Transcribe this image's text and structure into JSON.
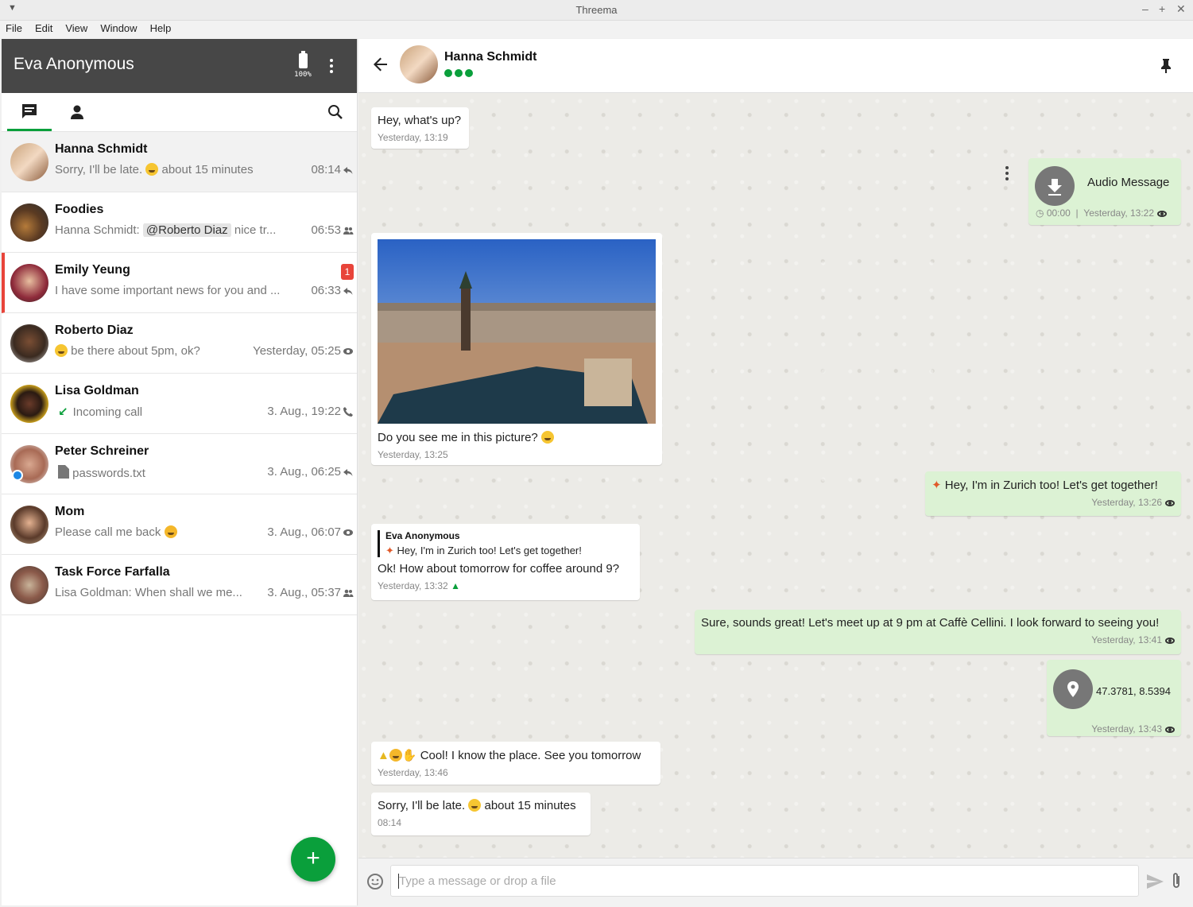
{
  "window": {
    "title": "Threema"
  },
  "menu": [
    "File",
    "Edit",
    "View",
    "Window",
    "Help"
  ],
  "sidebar": {
    "profile_name": "Eva Anonymous",
    "battery": "100%",
    "chats": [
      {
        "name": "Hanna Schmidt",
        "preview_a": "Sorry, I'll be late.",
        "preview_b": "about 15 minutes",
        "time": "08:14",
        "status": "reply-icon"
      },
      {
        "name": "Foodies",
        "preview_a": "Hanna Schmidt:",
        "mention": "@Roberto Diaz",
        "preview_b": "nice tr...",
        "time": "06:53",
        "status": "group-icon"
      },
      {
        "name": "Emily Yeung",
        "preview_a": "I have some important news for you and ...",
        "time": "06:33",
        "status": "reply-icon",
        "unread": "1"
      },
      {
        "name": "Roberto Diaz",
        "preview_a": "be there about 5pm, ok?",
        "time": "Yesterday, 05:25",
        "status": "eye-icon"
      },
      {
        "name": "Lisa Goldman",
        "preview_a": "Incoming call",
        "time": "3. Aug., 19:22",
        "status": "phone-icon"
      },
      {
        "name": "Peter Schreiner",
        "preview_a": "passwords.txt",
        "time": "3. Aug., 06:25",
        "status": "reply-icon"
      },
      {
        "name": "Mom",
        "preview_a": "Please call me back",
        "time": "3. Aug., 06:07",
        "status": "eye-icon"
      },
      {
        "name": "Task Force Farfalla",
        "preview_a": "Lisa Goldman: When shall we me...",
        "time": "3. Aug., 05:37",
        "status": "group-icon"
      }
    ],
    "fab": "+"
  },
  "chat": {
    "contact_name": "Hanna Schmidt",
    "messages": [
      {
        "text": "Hey, what's up?",
        "meta": "Yesterday, 13:19"
      },
      {
        "text": "Audio Message",
        "duration": "00:00",
        "meta": "Yesterday, 13:22"
      },
      {
        "text": "Do you see me in this picture?",
        "meta": "Yesterday, 13:25"
      },
      {
        "text": "Hey, I'm in Zurich too!  Let's get together!",
        "meta": "Yesterday, 13:26"
      },
      {
        "quote_name": "Eva Anonymous",
        "quote_text": "Hey, I'm in Zurich too! Let's get together!",
        "text": "Ok! How about tomorrow for coffee around 9?",
        "meta": "Yesterday, 13:32"
      },
      {
        "text": "Sure, sounds great! Let's meet up at 9 pm at Caffè Cellini. I look forward to seeing you!",
        "meta": "Yesterday, 13:41"
      },
      {
        "text": "47.3781, 8.5394",
        "meta": "Yesterday, 13:43"
      },
      {
        "text": "Cool! I know the place. See you tomorrow",
        "meta": "Yesterday, 13:46"
      },
      {
        "text_a": "Sorry, I'll be late.",
        "text_b": "about 15 minutes",
        "meta": "08:14"
      }
    ],
    "composer_placeholder": "Type a message or drop a file"
  },
  "colors": {
    "accent": "#0a9f3b",
    "header_dark": "#474747",
    "unread": "#e8443a",
    "outgoing_bubble": "#dcf2d4"
  }
}
